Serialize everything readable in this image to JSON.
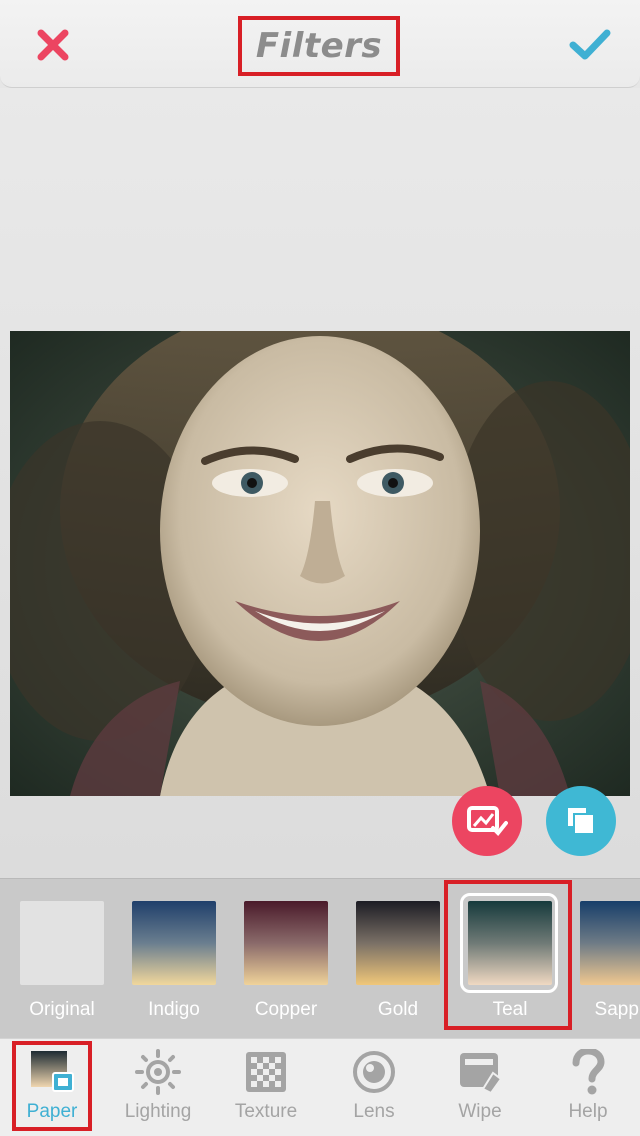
{
  "header": {
    "title": "Filters",
    "close_icon": "close-icon",
    "confirm_icon": "checkmark-icon"
  },
  "colors": {
    "accent_blue": "#3fb0d3",
    "accent_red": "#ec4561",
    "highlight_red": "#d81f26"
  },
  "actions": {
    "compare_icon": "compare-image-icon",
    "layers_icon": "copy-layers-icon"
  },
  "filters": [
    {
      "label": "Original",
      "top": "#e2e2e2",
      "bottom": "#e2e2e2"
    },
    {
      "label": "Indigo",
      "top": "#1f3f6b",
      "bottom": "#f1d79c"
    },
    {
      "label": "Copper",
      "top": "#4a1a2a",
      "bottom": "#f0d39a"
    },
    {
      "label": "Gold",
      "top": "#1c1c24",
      "bottom": "#f0c77a"
    },
    {
      "label": "Teal",
      "top": "#163a3c",
      "bottom": "#f0d9c2"
    },
    {
      "label": "Sapph",
      "top": "#173e6a",
      "bottom": "#f0c890"
    }
  ],
  "selected_filter": "Teal",
  "tools": [
    {
      "label": "Paper",
      "icon": "paper-icon",
      "active": true
    },
    {
      "label": "Lighting",
      "icon": "sun-icon",
      "active": false
    },
    {
      "label": "Texture",
      "icon": "checkerboard-icon",
      "active": false
    },
    {
      "label": "Lens",
      "icon": "lens-icon",
      "active": false
    },
    {
      "label": "Wipe",
      "icon": "eraser-icon",
      "active": false
    },
    {
      "label": "Help",
      "icon": "question-icon",
      "active": false
    }
  ]
}
